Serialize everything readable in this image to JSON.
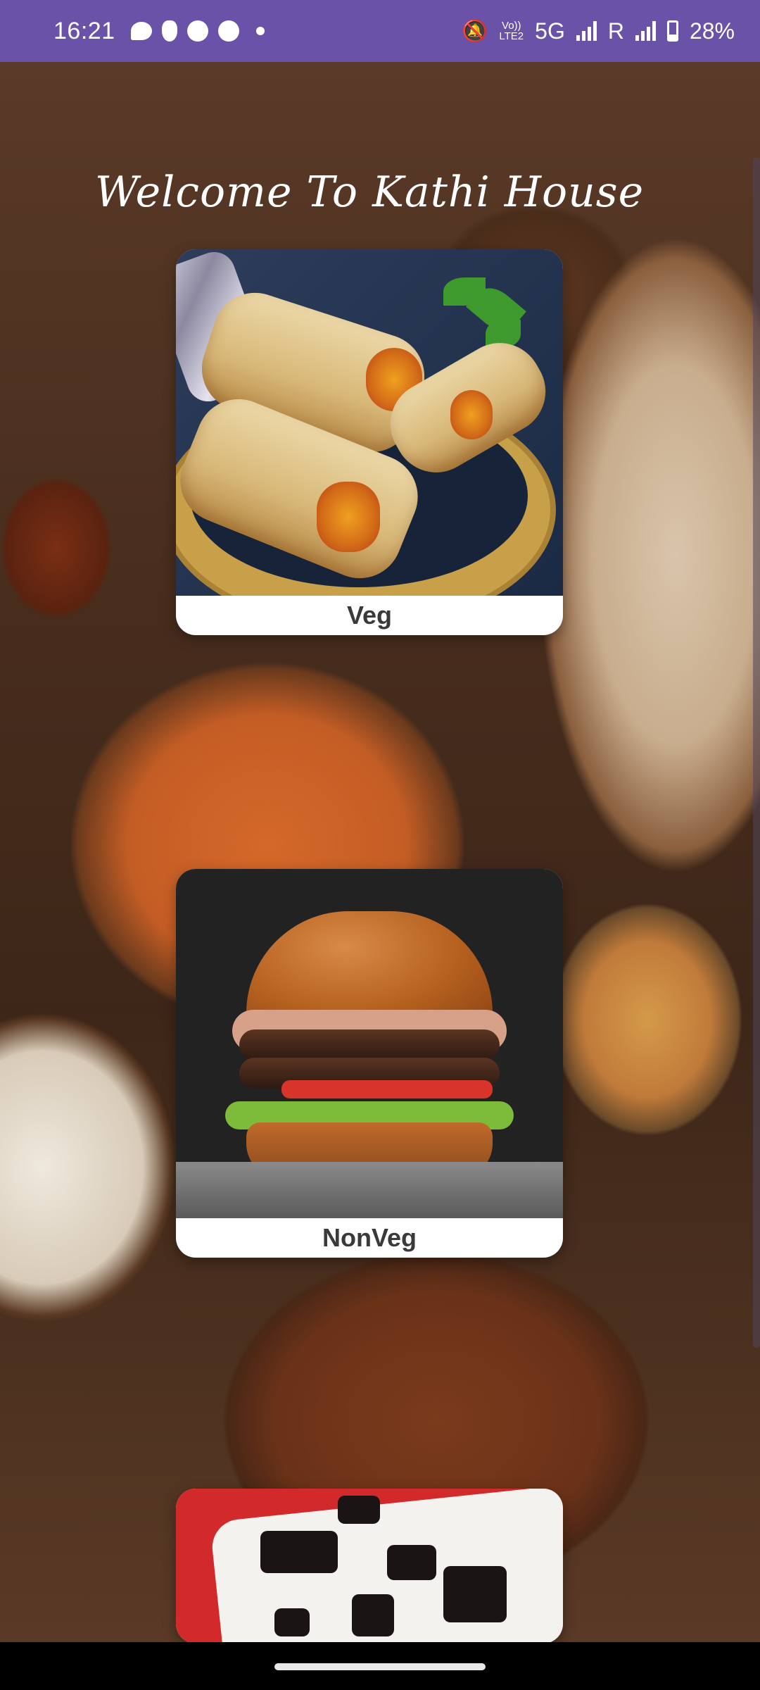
{
  "status_bar": {
    "time": "16:21",
    "network": "5G",
    "volte": "Vo))\nLTE2",
    "roaming": "R",
    "battery": "28%",
    "left_icons": [
      "chat-icon",
      "app-icon",
      "gauge-icon",
      "gauge-icon",
      "dot-icon"
    ],
    "right_icons": [
      "mute-icon",
      "signal-icon",
      "signal-icon",
      "battery-icon"
    ]
  },
  "app": {
    "welcome": "Welcome To Kathi House",
    "categories": [
      {
        "label": "Veg"
      },
      {
        "label": "NonVeg"
      },
      {
        "label": ""
      }
    ]
  },
  "colors": {
    "status_bar": "#6a52a8",
    "card_bg": "#ffffff",
    "label_text": "#3a3a3a",
    "title_text": "#ffffff"
  }
}
